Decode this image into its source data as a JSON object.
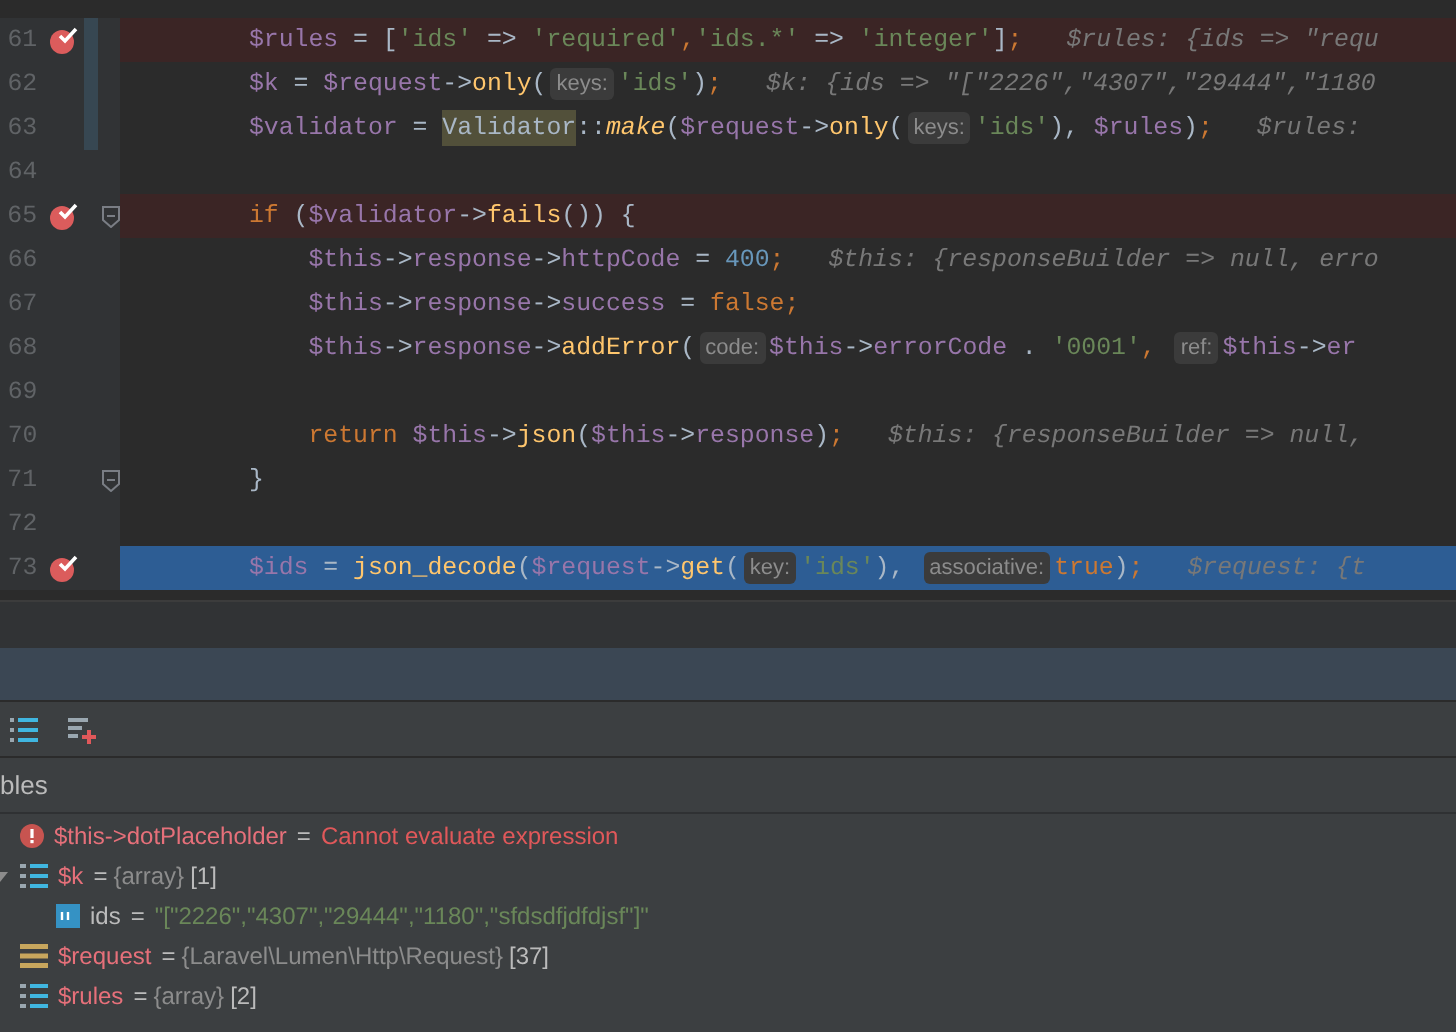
{
  "editor": {
    "lines": [
      {
        "number": "61",
        "breakpoint": true,
        "changed": true,
        "current": false,
        "tokens": [
          {
            "kind": "var",
            "text": "        $rules"
          },
          {
            "kind": "op",
            "text": " = ["
          },
          {
            "kind": "str",
            "text": "'ids'"
          },
          {
            "kind": "op",
            "text": " => "
          },
          {
            "kind": "str",
            "text": "'required'"
          },
          {
            "kind": "kw",
            "text": ","
          },
          {
            "kind": "str",
            "text": "'ids.*'"
          },
          {
            "kind": "op",
            "text": " => "
          },
          {
            "kind": "str",
            "text": "'integer'"
          },
          {
            "kind": "op",
            "text": "]"
          },
          {
            "kind": "kw",
            "text": ";"
          },
          {
            "kind": "debug",
            "text": "$rules: {ids => \"requ"
          }
        ]
      },
      {
        "number": "62",
        "breakpoint": false,
        "changed": true,
        "current": false,
        "tokens": [
          {
            "kind": "var",
            "text": "        $k"
          },
          {
            "kind": "op",
            "text": " = "
          },
          {
            "kind": "var",
            "text": "$request"
          },
          {
            "kind": "op",
            "text": "->"
          },
          {
            "kind": "fn",
            "text": "only"
          },
          {
            "kind": "op",
            "text": "("
          },
          {
            "kind": "hint",
            "text": "keys:"
          },
          {
            "kind": "str",
            "text": "'ids'"
          },
          {
            "kind": "op",
            "text": ")"
          },
          {
            "kind": "kw",
            "text": ";"
          },
          {
            "kind": "debug",
            "text": "$k: {ids => \"[\"2226\",\"4307\",\"29444\",\"1180"
          }
        ]
      },
      {
        "number": "63",
        "breakpoint": false,
        "changed": true,
        "current": false,
        "tokens": [
          {
            "kind": "var",
            "text": "        $validator"
          },
          {
            "kind": "op",
            "text": " = "
          },
          {
            "kind": "cls",
            "text": "Validator"
          },
          {
            "kind": "op",
            "text": "::"
          },
          {
            "kind": "static",
            "text": "make"
          },
          {
            "kind": "op",
            "text": "("
          },
          {
            "kind": "var",
            "text": "$request"
          },
          {
            "kind": "op",
            "text": "->"
          },
          {
            "kind": "fn",
            "text": "only"
          },
          {
            "kind": "op",
            "text": "("
          },
          {
            "kind": "hint",
            "text": "keys:"
          },
          {
            "kind": "str",
            "text": "'ids'"
          },
          {
            "kind": "op",
            "text": "), "
          },
          {
            "kind": "var",
            "text": "$rules"
          },
          {
            "kind": "op",
            "text": ")"
          },
          {
            "kind": "kw",
            "text": ";"
          },
          {
            "kind": "debug",
            "text": "$rules:"
          }
        ]
      },
      {
        "number": "64",
        "breakpoint": false,
        "changed": false,
        "current": false
      },
      {
        "number": "65",
        "breakpoint": true,
        "changed": false,
        "fold": true,
        "current": false,
        "tokens": [
          {
            "kind": "kw",
            "text": "        if"
          },
          {
            "kind": "op",
            "text": " ("
          },
          {
            "kind": "var",
            "text": "$validator"
          },
          {
            "kind": "op",
            "text": "->"
          },
          {
            "kind": "fn",
            "text": "fails"
          },
          {
            "kind": "op",
            "text": "()) {"
          }
        ]
      },
      {
        "number": "66",
        "breakpoint": false,
        "changed": false,
        "current": false,
        "tokens": [
          {
            "kind": "var",
            "text": "            $this"
          },
          {
            "kind": "op",
            "text": "->"
          },
          {
            "kind": "var",
            "text": "response"
          },
          {
            "kind": "op",
            "text": "->"
          },
          {
            "kind": "var",
            "text": "httpCode"
          },
          {
            "kind": "op",
            "text": " = "
          },
          {
            "kind": "num",
            "text": "400"
          },
          {
            "kind": "kw",
            "text": ";"
          },
          {
            "kind": "debug",
            "text": "$this: {responseBuilder => null, erro"
          }
        ]
      },
      {
        "number": "67",
        "breakpoint": false,
        "changed": false,
        "current": false,
        "tokens": [
          {
            "kind": "var",
            "text": "            $this"
          },
          {
            "kind": "op",
            "text": "->"
          },
          {
            "kind": "var",
            "text": "response"
          },
          {
            "kind": "op",
            "text": "->"
          },
          {
            "kind": "var",
            "text": "success"
          },
          {
            "kind": "op",
            "text": " = "
          },
          {
            "kind": "kw",
            "text": "false;"
          }
        ]
      },
      {
        "number": "68",
        "breakpoint": false,
        "changed": false,
        "current": false,
        "tokens": [
          {
            "kind": "var",
            "text": "            $this"
          },
          {
            "kind": "op",
            "text": "->"
          },
          {
            "kind": "var",
            "text": "response"
          },
          {
            "kind": "op",
            "text": "->"
          },
          {
            "kind": "fn",
            "text": "addError"
          },
          {
            "kind": "op",
            "text": "("
          },
          {
            "kind": "hint",
            "text": "code:"
          },
          {
            "kind": "var",
            "text": "$this"
          },
          {
            "kind": "op",
            "text": "->"
          },
          {
            "kind": "var",
            "text": "errorCode"
          },
          {
            "kind": "op",
            "text": " . "
          },
          {
            "kind": "str",
            "text": "'0001'"
          },
          {
            "kind": "kw",
            "text": ", "
          },
          {
            "kind": "hint",
            "text": "ref:"
          },
          {
            "kind": "var",
            "text": "$this"
          },
          {
            "kind": "op",
            "text": "->"
          },
          {
            "kind": "var",
            "text": "er"
          }
        ]
      },
      {
        "number": "69",
        "breakpoint": false,
        "changed": false,
        "current": false
      },
      {
        "number": "70",
        "breakpoint": false,
        "changed": false,
        "current": false,
        "tokens": [
          {
            "kind": "kw",
            "text": "            return"
          },
          {
            "kind": "var",
            "text": " $this"
          },
          {
            "kind": "op",
            "text": "->"
          },
          {
            "kind": "fn",
            "text": "json"
          },
          {
            "kind": "op",
            "text": "("
          },
          {
            "kind": "var",
            "text": "$this"
          },
          {
            "kind": "op",
            "text": "->"
          },
          {
            "kind": "var",
            "text": "response"
          },
          {
            "kind": "op",
            "text": ")"
          },
          {
            "kind": "kw",
            "text": ";"
          },
          {
            "kind": "debug",
            "text": "$this: {responseBuilder => null,"
          }
        ]
      },
      {
        "number": "71",
        "breakpoint": false,
        "changed": false,
        "fold": true,
        "current": false,
        "tokens": [
          {
            "kind": "op",
            "text": "        }"
          }
        ]
      },
      {
        "number": "72",
        "breakpoint": false,
        "changed": false,
        "current": false
      },
      {
        "number": "73",
        "breakpoint": true,
        "changed": false,
        "current": true,
        "tokens": [
          {
            "kind": "var",
            "text": "        $ids"
          },
          {
            "kind": "op",
            "text": " = "
          },
          {
            "kind": "fn",
            "text": "json_decode"
          },
          {
            "kind": "op",
            "text": "("
          },
          {
            "kind": "var",
            "text": "$request"
          },
          {
            "kind": "op",
            "text": "->"
          },
          {
            "kind": "fn",
            "text": "get"
          },
          {
            "kind": "op",
            "text": "("
          },
          {
            "kind": "hint",
            "text": "key:"
          },
          {
            "kind": "str",
            "text": "'ids'"
          },
          {
            "kind": "op",
            "text": "), "
          },
          {
            "kind": "hint",
            "text": "associative:"
          },
          {
            "kind": "kw",
            "text": "true"
          },
          {
            "kind": "op",
            "text": ")"
          },
          {
            "kind": "kw",
            "text": ";"
          },
          {
            "kind": "debug",
            "text": "$request: {t"
          }
        ]
      }
    ]
  },
  "variables": {
    "title": "bles",
    "rows": [
      {
        "kind": "error",
        "name": "$this->dotPlaceholder",
        "operator": "=",
        "value": "Cannot evaluate expression"
      },
      {
        "kind": "array",
        "name": "$k",
        "operator": "=",
        "type": "{array}",
        "count": "[1]",
        "expanded": true,
        "children": [
          {
            "kind": "scalar",
            "name": "ids",
            "operator": "=",
            "value": "\"[\"2226\",\"4307\",\"29444\",\"1180\",\"sfdsdfjdfdjsf\"]\""
          }
        ]
      },
      {
        "kind": "object",
        "name": "$request",
        "operator": "=",
        "type": "{Laravel\\Lumen\\Http\\Request}",
        "count": "[37]"
      },
      {
        "kind": "array",
        "name": "$rules",
        "operator": "=",
        "type": "{array}",
        "count": "[2]"
      }
    ]
  }
}
